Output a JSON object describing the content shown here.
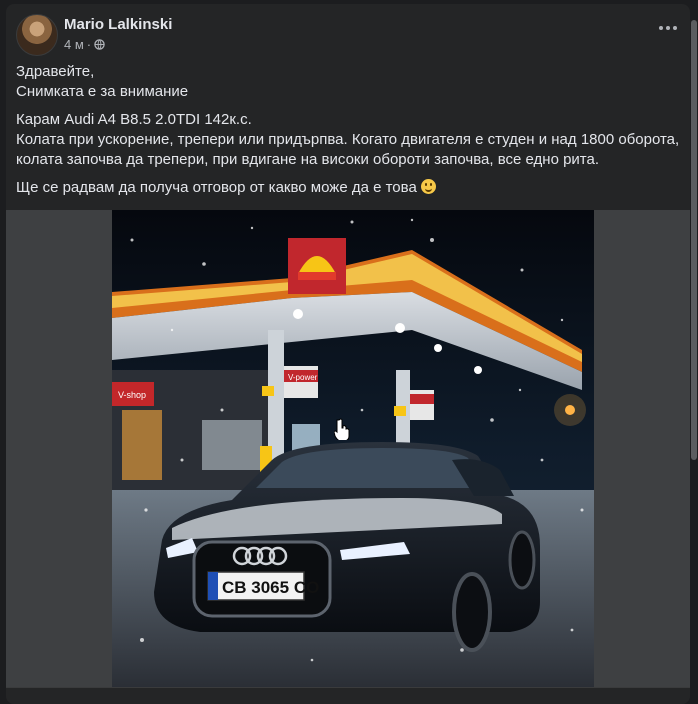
{
  "post": {
    "author": "Mario Lalkinski",
    "time": "4 м",
    "separator": "·",
    "lines": [
      "Здравейте,",
      "Снимката е за внимание"
    ],
    "car_line": "Карам Audi A4 B8.5 2.0TDI 142к.с.",
    "problem": "Колата при ускорение, трепери или придърпва. Когато двигателя е студен и над 1800 оборота, колата започва да трепери, при вдигане на високи обороти започва, все едно рита.",
    "closing": "Ще се радвам да получа отговор от какво може да е това"
  },
  "photo": {
    "plate": "CB 3065 CO",
    "brand_sign": "V-power",
    "shop_sign": "V-shop"
  },
  "icons": {
    "privacy": "globe-icon",
    "more": "more-horizontal-icon",
    "emoji": "smile-emoji-icon"
  },
  "colors": {
    "background": "#18191a",
    "card": "#242526",
    "text": "#e4e6eb",
    "secondary": "#b0b3b8"
  }
}
